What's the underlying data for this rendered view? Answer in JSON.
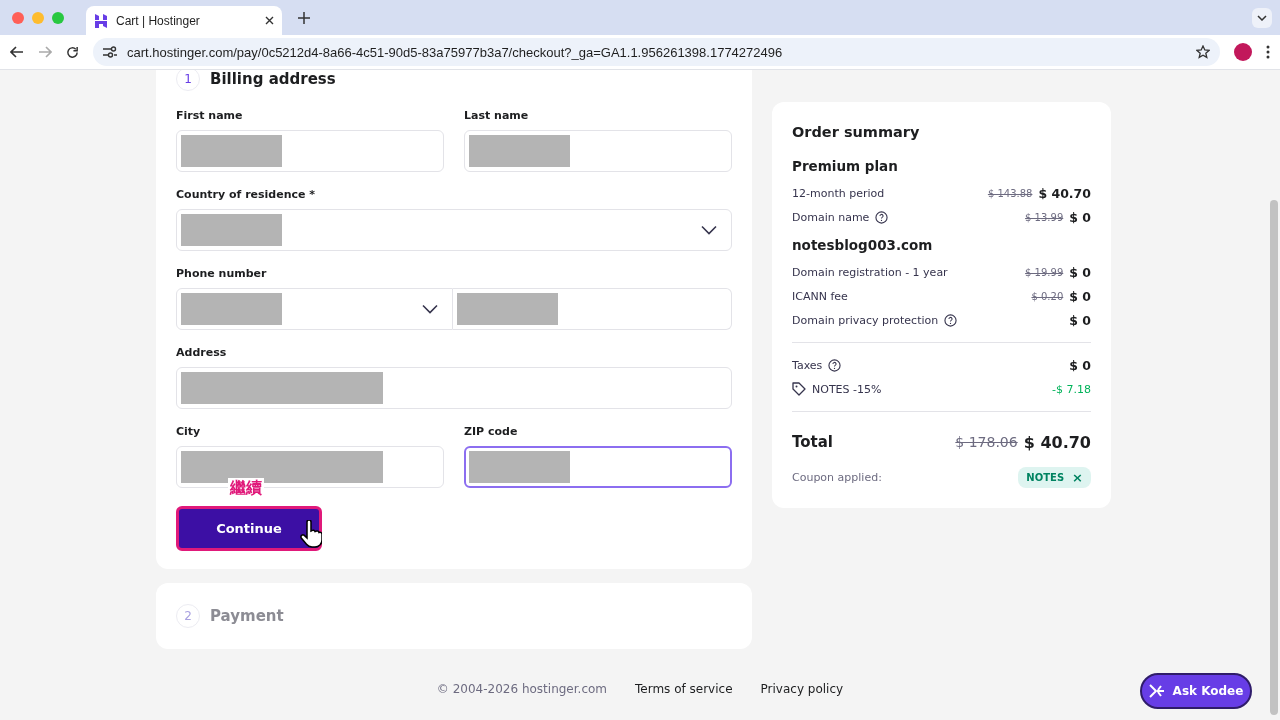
{
  "browser": {
    "tab_title": "Cart | Hostinger",
    "url": "cart.hostinger.com/pay/0c5212d4-8a66-4c51-90d5-83a75977b3a7/checkout?_ga=GA1.1.956261398.1774272496"
  },
  "billing": {
    "step": "1",
    "title": "Billing address",
    "rows": [
      {
        "fields": [
          {
            "label": "First name",
            "kind": "text",
            "redacted": true,
            "focused": false
          },
          {
            "label": "Last name",
            "kind": "text",
            "redacted": true,
            "focused": false
          }
        ]
      },
      {
        "fields": [
          {
            "label": "Country of residence *",
            "kind": "select",
            "redacted": true,
            "focused": false
          }
        ]
      },
      {
        "fields": [
          {
            "label": "Phone number",
            "kind": "phone",
            "redacted": true,
            "focused": false
          }
        ]
      },
      {
        "fields": [
          {
            "label": "Address",
            "kind": "text",
            "redacted": true,
            "focused": false,
            "wide": true
          }
        ]
      },
      {
        "fields": [
          {
            "label": "City",
            "kind": "text",
            "redacted": true,
            "focused": false,
            "wide": true
          },
          {
            "label": "ZIP code",
            "kind": "text",
            "redacted": true,
            "focused": true
          }
        ]
      }
    ],
    "annotation": "繼續",
    "button": "Continue"
  },
  "payment": {
    "step": "2",
    "title": "Payment"
  },
  "summary": {
    "title": "Order summary",
    "rows": [
      {
        "kind": "heading",
        "label": "Premium plan"
      },
      {
        "kind": "line",
        "label": "12-month period",
        "help": false,
        "old": "$ 143.88",
        "price": "$ 40.70"
      },
      {
        "kind": "line",
        "label": "Domain name",
        "help": true,
        "old": "$ 13.99",
        "price": "$ 0"
      },
      {
        "kind": "heading",
        "label": "notesblog003.com"
      },
      {
        "kind": "line",
        "label": "Domain registration - 1 year",
        "help": false,
        "old": "$ 19.99",
        "price": "$ 0"
      },
      {
        "kind": "line",
        "label": "ICANN fee",
        "help": false,
        "old": "$ 0.20",
        "price": "$ 0"
      },
      {
        "kind": "line",
        "label": "Domain privacy protection",
        "help": true,
        "price": "$ 0"
      },
      {
        "kind": "divider"
      },
      {
        "kind": "line",
        "label": "Taxes",
        "help": true,
        "price": "$ 0"
      },
      {
        "kind": "discount",
        "label": "NOTES -15%",
        "price": "-$ 7.18"
      },
      {
        "kind": "divider"
      },
      {
        "kind": "total",
        "label": "Total",
        "old": "$ 178.06",
        "price": "$ 40.70"
      },
      {
        "kind": "coupon",
        "label": "Coupon applied:",
        "code": "NOTES",
        "remove": "×"
      }
    ]
  },
  "footer": {
    "copyright": "© 2004-2026 hostinger.com",
    "links": [
      "Terms of service",
      "Privacy policy"
    ],
    "chat_button": "Ask Kodee"
  }
}
